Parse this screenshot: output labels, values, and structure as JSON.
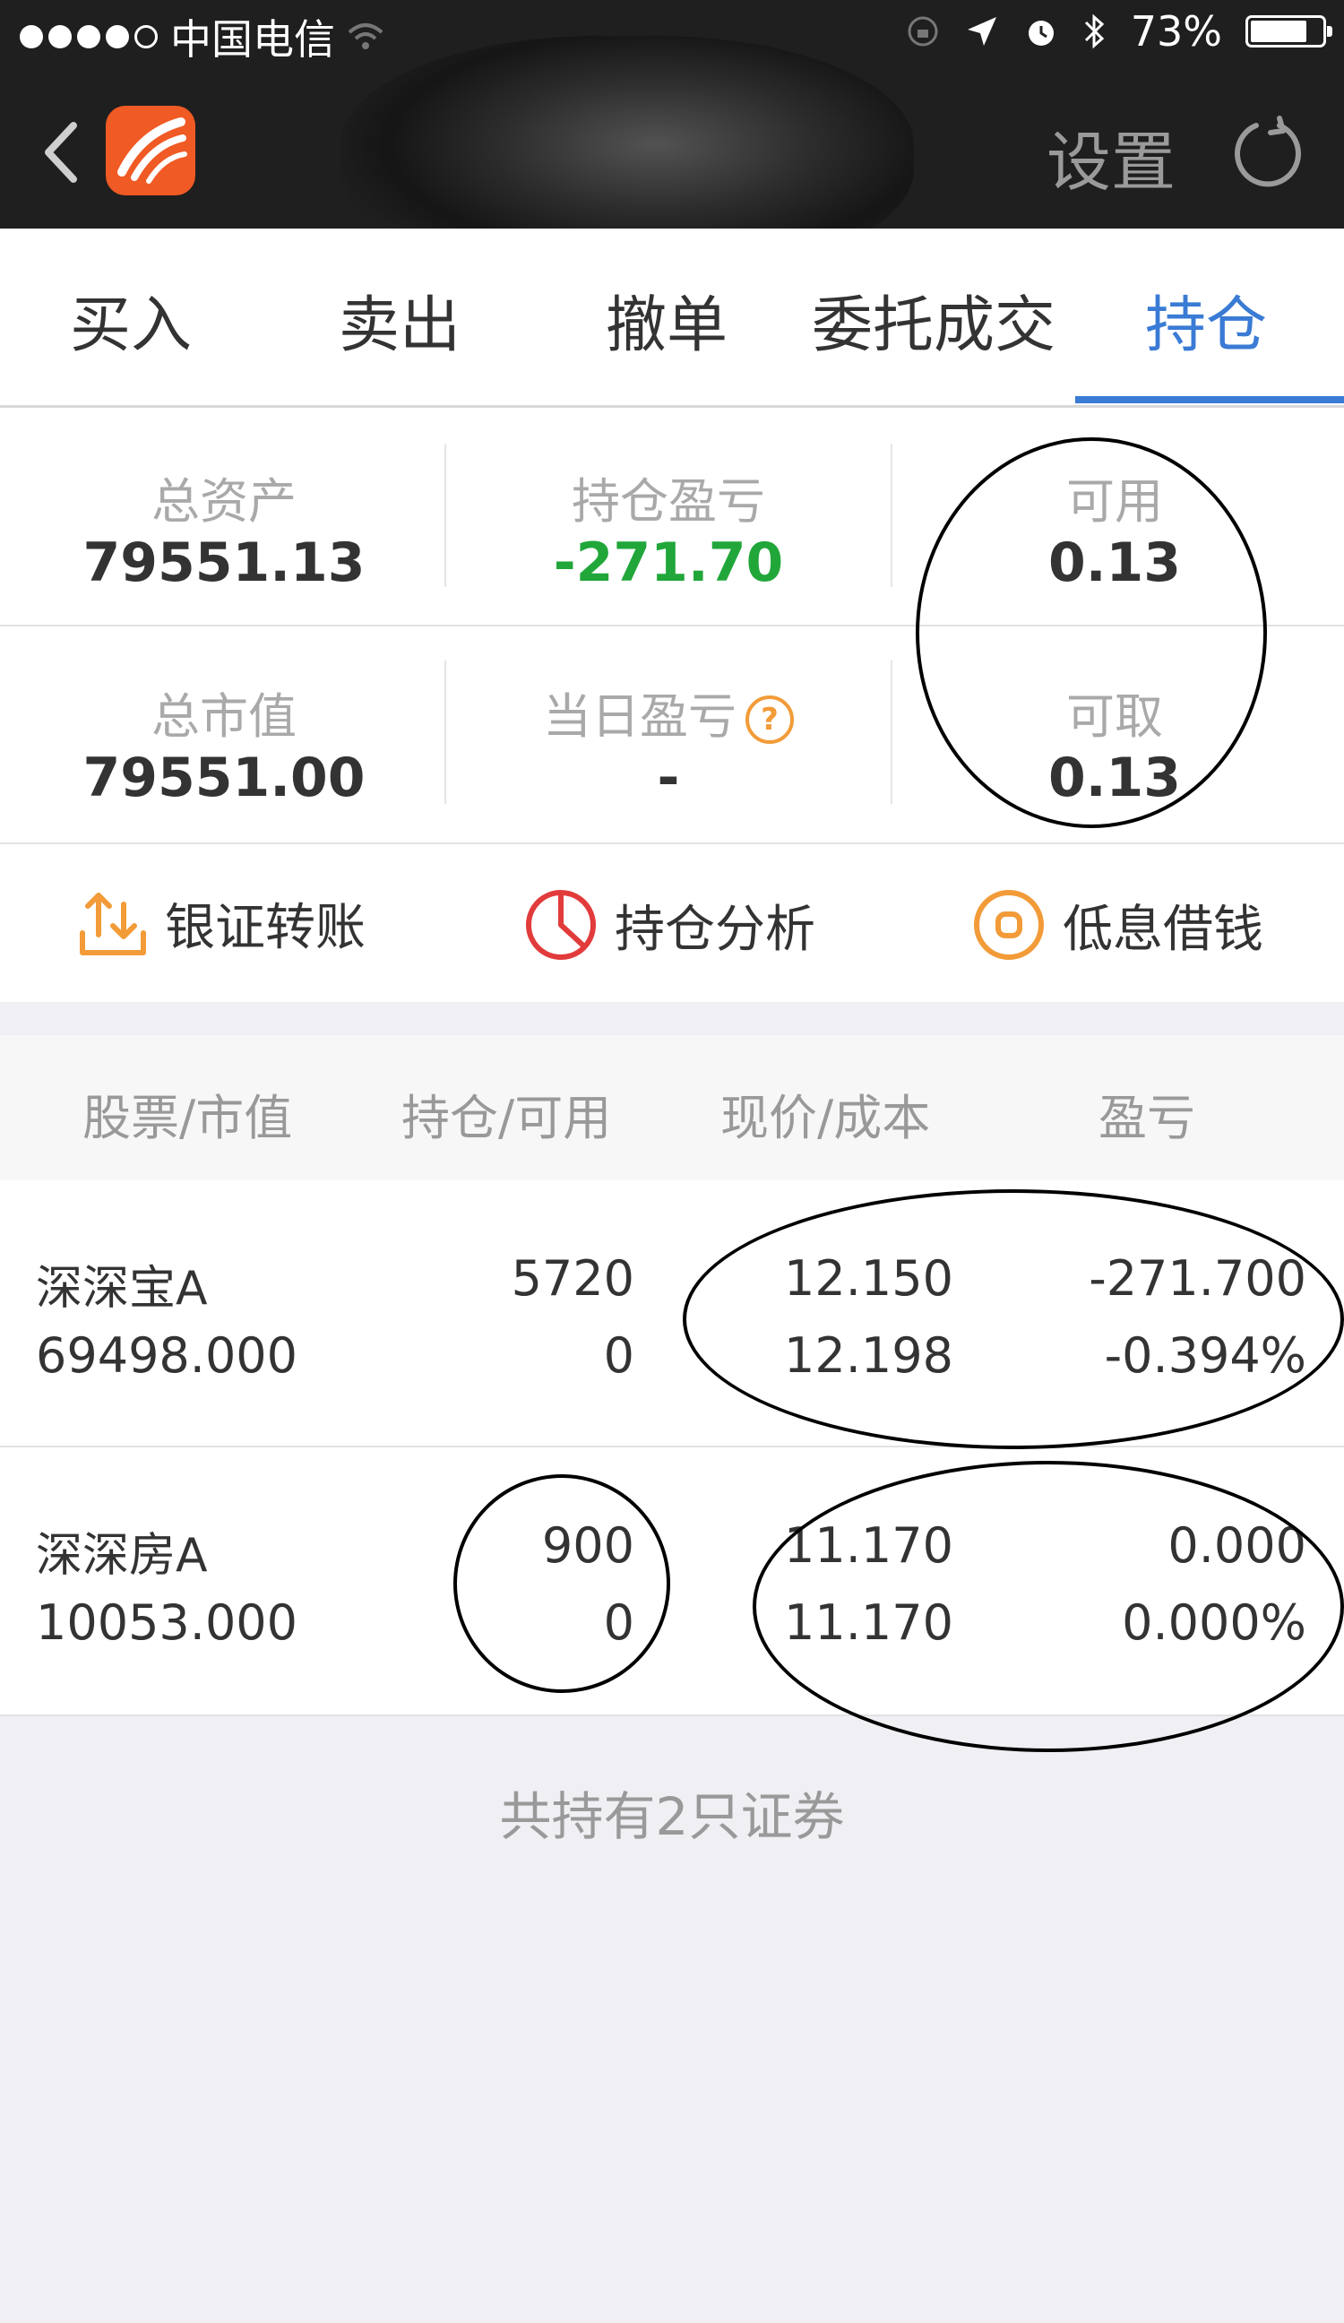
{
  "status_bar": {
    "carrier": "中国电信",
    "battery": "73%"
  },
  "nav": {
    "settings_label": "设置"
  },
  "tabs": [
    {
      "label": "买入"
    },
    {
      "label": "卖出"
    },
    {
      "label": "撤单"
    },
    {
      "label": "委托成交"
    },
    {
      "label": "持仓"
    }
  ],
  "summary": {
    "total_assets": {
      "label": "总资产",
      "value": "79551.13"
    },
    "position_pnl": {
      "label": "持仓盈亏",
      "value": "-271.70"
    },
    "available": {
      "label": "可用",
      "value": "0.13"
    },
    "market_value": {
      "label": "总市值",
      "value": "79551.00"
    },
    "daily_pnl": {
      "label": "当日盈亏",
      "value": "-"
    },
    "withdrawable": {
      "label": "可取",
      "value": "0.13"
    }
  },
  "actions": [
    {
      "label": "银证转账",
      "icon": "transfer-icon"
    },
    {
      "label": "持仓分析",
      "icon": "pie-chart-icon"
    },
    {
      "label": "低息借钱",
      "icon": "coin-icon"
    }
  ],
  "table": {
    "headers": [
      "股票/市值",
      "持仓/可用",
      "现价/成本",
      "盈亏"
    ],
    "rows": [
      {
        "name": "深深宝A",
        "market_value": "69498.000",
        "position": "5720",
        "available": "0",
        "price": "12.150",
        "cost": "12.198",
        "pnl": "-271.700",
        "pnl_pct": "-0.394%"
      },
      {
        "name": "深深房A",
        "market_value": "10053.000",
        "position": "900",
        "available": "0",
        "price": "11.170",
        "cost": "11.170",
        "pnl": "0.000",
        "pnl_pct": "0.000%"
      }
    ]
  },
  "footer": "共持有2只证券",
  "colors": {
    "accent": "#3a7bd5",
    "gain": "#e23b3b",
    "loss": "#21a63a",
    "logo": "#f05a24",
    "help": "#f29b38"
  }
}
